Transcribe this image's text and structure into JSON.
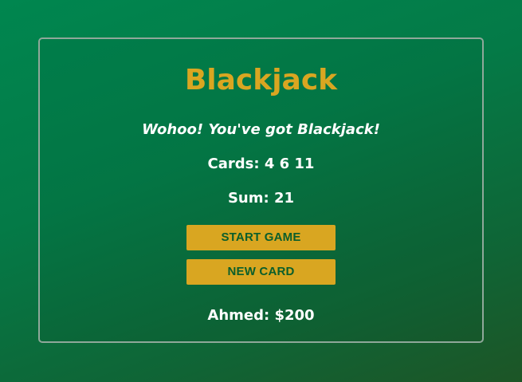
{
  "game": {
    "title": "Blackjack",
    "message": "Wohoo! You've got Blackjack!",
    "cards_text": "Cards: 4 6 11",
    "sum_text": "Sum: 21",
    "start_button_label": "START GAME",
    "new_card_button_label": "NEW CARD",
    "player_text": "Ahmed: $200"
  },
  "colors": {
    "background": "#047a47",
    "accent": "#d9a621",
    "button_text": "#0a5e2b",
    "text": "#ffffff",
    "panel_border": "#8fa89a"
  }
}
